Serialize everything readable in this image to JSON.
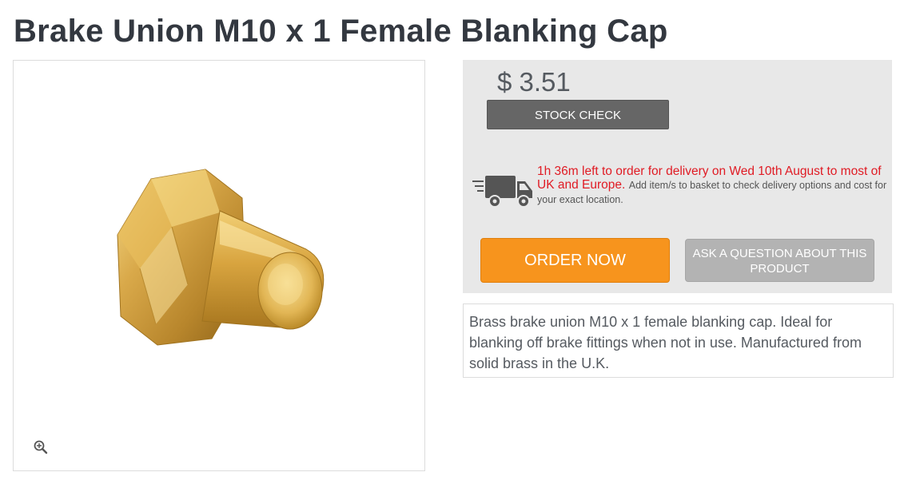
{
  "product": {
    "title": "Brake Union M10 x 1 Female Blanking Cap",
    "price": "$ 3.51",
    "description": "Brass brake union M10 x 1 female blanking cap. Ideal for blanking off brake fittings when not in use. Manufactured from solid brass in the U.K."
  },
  "buttons": {
    "stock_check": "STOCK CHECK",
    "order_now": "ORDER NOW",
    "ask_question": "ASK A QUESTION ABOUT THIS PRODUCT"
  },
  "delivery": {
    "deadline_text": "1h 36m left to order for delivery on Wed 10th August to most of UK and Europe.",
    "note_text": "Add item/s to basket to check delivery options and cost for your exact location."
  },
  "icons": {
    "zoom": "zoom-in-icon",
    "delivery": "delivery-truck-icon"
  },
  "colors": {
    "title": "#333840",
    "order_button": "#f7941d",
    "stock_button": "#666666",
    "ask_button": "#b3b3b3",
    "delivery_deadline": "#e01b24",
    "buy_panel_bg": "#e8e8e8"
  }
}
